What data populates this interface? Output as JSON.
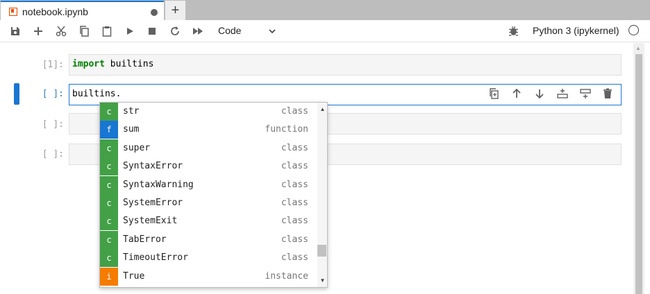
{
  "tab": {
    "title": "notebook.ipynb",
    "new_tab": "+"
  },
  "toolbar": {
    "buttons": [
      "save-icon",
      "add-icon",
      "cut-icon",
      "copy-icon",
      "paste-icon",
      "run-icon",
      "stop-icon",
      "restart-icon",
      "fast-forward-icon"
    ],
    "cell_type": "Code",
    "kernel_name": "Python 3 (ipykernel)"
  },
  "cells": [
    {
      "prompt": "[1]:",
      "code_kw": "import",
      "code_rest": " builtins"
    },
    {
      "prompt": "[ ]:",
      "code": "builtins."
    },
    {
      "prompt": "[ ]:",
      "code": ""
    },
    {
      "prompt": "[ ]:",
      "code": ""
    }
  ],
  "completer": {
    "items": [
      {
        "type": "c",
        "label": "str",
        "kind": "class",
        "color": "#43a047"
      },
      {
        "type": "f",
        "label": "sum",
        "kind": "function",
        "color": "#1976d2"
      },
      {
        "type": "c",
        "label": "super",
        "kind": "class",
        "color": "#43a047"
      },
      {
        "type": "c",
        "label": "SyntaxError",
        "kind": "class",
        "color": "#43a047"
      },
      {
        "type": "c",
        "label": "SyntaxWarning",
        "kind": "class",
        "color": "#43a047"
      },
      {
        "type": "c",
        "label": "SystemError",
        "kind": "class",
        "color": "#43a047"
      },
      {
        "type": "c",
        "label": "SystemExit",
        "kind": "class",
        "color": "#43a047"
      },
      {
        "type": "c",
        "label": "TabError",
        "kind": "class",
        "color": "#43a047"
      },
      {
        "type": "c",
        "label": "TimeoutError",
        "kind": "class",
        "color": "#43a047"
      },
      {
        "type": "i",
        "label": "True",
        "kind": "instance",
        "color": "#f57c00"
      }
    ]
  },
  "colors": {
    "accent": "#1976d2"
  }
}
